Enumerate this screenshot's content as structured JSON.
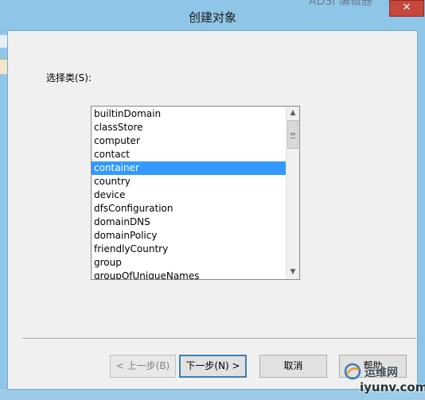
{
  "window": {
    "title": "创建对象",
    "close_glyph": "✕"
  },
  "background": {
    "fragment_text": "ADSI 编辑器"
  },
  "main": {
    "choose_label": "选择类(S):",
    "classes": [
      {
        "label": "builtinDomain",
        "selected": false
      },
      {
        "label": "classStore",
        "selected": false
      },
      {
        "label": "computer",
        "selected": false
      },
      {
        "label": "contact",
        "selected": false
      },
      {
        "label": "container",
        "selected": true
      },
      {
        "label": "country",
        "selected": false
      },
      {
        "label": "device",
        "selected": false
      },
      {
        "label": "dfsConfiguration",
        "selected": false
      },
      {
        "label": "domainDNS",
        "selected": false
      },
      {
        "label": "domainPolicy",
        "selected": false
      },
      {
        "label": "friendlyCountry",
        "selected": false
      },
      {
        "label": "group",
        "selected": false
      },
      {
        "label": "groupOfUniqueNames",
        "selected": false
      }
    ],
    "scroll_up_glyph": "▲",
    "scroll_down_glyph": "▼"
  },
  "buttons": {
    "back_label": "< 上一步(B)",
    "next_label": "下一步(N) >",
    "cancel_label": "取消",
    "help_label": "帮助"
  },
  "watermark": {
    "top": "运维网",
    "bottom": "iyunv.com"
  },
  "colors": {
    "title_bar": "#8fc6e8",
    "selection": "#3399ff",
    "close_button": "#c7473c"
  }
}
